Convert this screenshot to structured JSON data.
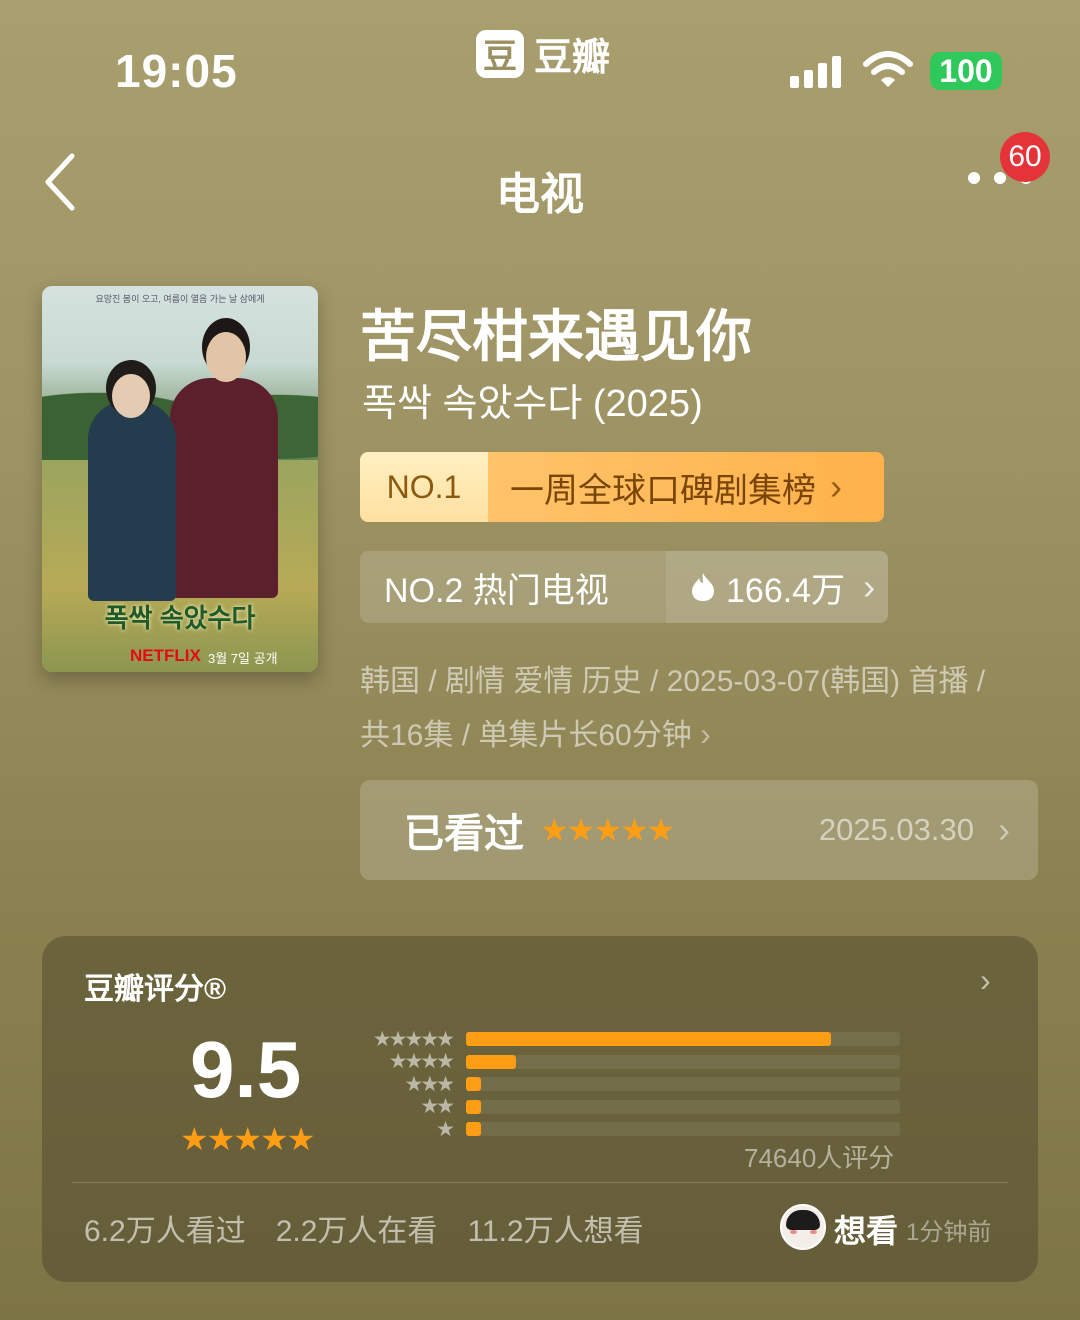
{
  "status_bar": {
    "time": "19:05",
    "app_name": "豆瓣",
    "app_icon_glyph": "豆",
    "battery": "100"
  },
  "nav": {
    "title": "电视",
    "notification_count": "60"
  },
  "poster": {
    "korean_title": "폭싹 속았수다",
    "brand": "NETFLIX",
    "release_note": "3월 7일 공개",
    "tagline": "요망진 봄이 오고, 여름이 열음 가는 날 삼에게"
  },
  "show": {
    "title": "苦尽柑来遇见你",
    "original_title": "폭싹 속았수다 (2025)",
    "rank1": {
      "no": "NO.1",
      "label": "一周全球口碑剧集榜"
    },
    "rank2": {
      "label": "NO.2 热门电视",
      "heat": "166.4万"
    },
    "meta_line1": "韩国 / 剧情 爱情 历史 / 2025-03-07(韩国) 首播 /",
    "meta_line2": "共16集 / 单集片长60分钟"
  },
  "watched": {
    "label": "已看过",
    "stars": 5,
    "date": "2025.03.30"
  },
  "rating": {
    "title": "豆瓣评分®",
    "score": "9.5",
    "stars": 5,
    "count": "74640人评分",
    "distribution": [
      {
        "stars": 5,
        "fraction": 0.84
      },
      {
        "stars": 4,
        "fraction": 0.115
      },
      {
        "stars": 3,
        "fraction": 0.035
      },
      {
        "stars": 2,
        "fraction": 0.035
      },
      {
        "stars": 1,
        "fraction": 0.035
      }
    ],
    "watched": "6.2万人看过",
    "watching": "2.2万人在看",
    "want": "11.2万人想看",
    "friend_action": "想看",
    "friend_time": "1分钟前"
  },
  "colors": {
    "accent_star": "#ff9d14",
    "badge_red": "#e5333a",
    "battery_green": "#2fc85a"
  }
}
